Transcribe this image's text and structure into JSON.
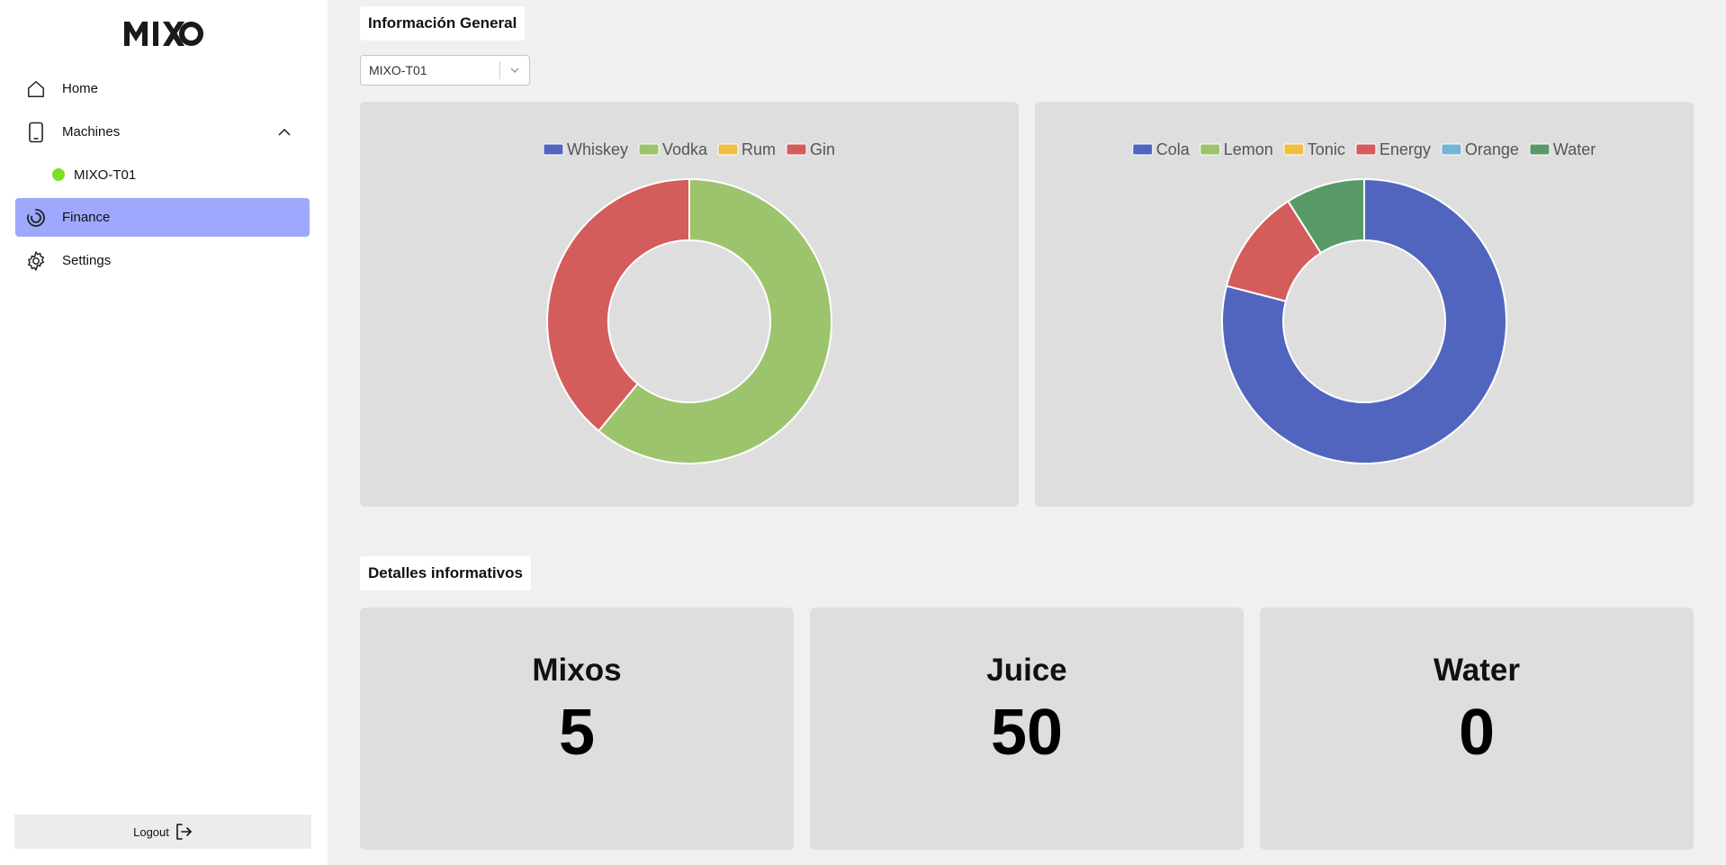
{
  "brand": {
    "name": "MIXO"
  },
  "sidebar": {
    "items": [
      {
        "label": "Home",
        "icon": "home-icon"
      },
      {
        "label": "Machines",
        "icon": "tablet-icon"
      },
      {
        "label": "Finance",
        "icon": "spiral-icon",
        "active": true
      },
      {
        "label": "Settings",
        "icon": "gear-icon"
      }
    ],
    "machines": [
      {
        "label": "MIXO-T01",
        "status_color": "#7be02b"
      }
    ],
    "logout_label": "Logout"
  },
  "general": {
    "title": "Información General",
    "machine_select": {
      "value": "MIXO-T01"
    }
  },
  "details": {
    "title": "Detalles informativos",
    "cards": [
      {
        "label": "Mixos",
        "value": "5"
      },
      {
        "label": "Juice",
        "value": "50"
      },
      {
        "label": "Water",
        "value": "0"
      }
    ]
  },
  "colors": {
    "accent": "#9ea8fc",
    "card_bg": "#dedede",
    "page_bg": "#f0f0f0"
  },
  "chart_data": [
    {
      "type": "doughnut",
      "legend_position": "top",
      "series": [
        {
          "name": "Whiskey",
          "value": 0,
          "color": "#5165bf"
        },
        {
          "name": "Vodka",
          "value": 61,
          "color": "#9bc46c"
        },
        {
          "name": "Rum",
          "value": 0,
          "color": "#f2bf44"
        },
        {
          "name": "Gin",
          "value": 39,
          "color": "#d45d5c"
        }
      ]
    },
    {
      "type": "doughnut",
      "legend_position": "top",
      "series": [
        {
          "name": "Cola",
          "value": 79,
          "color": "#5165bf"
        },
        {
          "name": "Lemon",
          "value": 0,
          "color": "#9bc46c"
        },
        {
          "name": "Tonic",
          "value": 0,
          "color": "#f2bf44"
        },
        {
          "name": "Energy",
          "value": 12,
          "color": "#d45d5c"
        },
        {
          "name": "Orange",
          "value": 0,
          "color": "#72b5d6"
        },
        {
          "name": "Water",
          "value": 9,
          "color": "#579a68"
        }
      ]
    }
  ]
}
